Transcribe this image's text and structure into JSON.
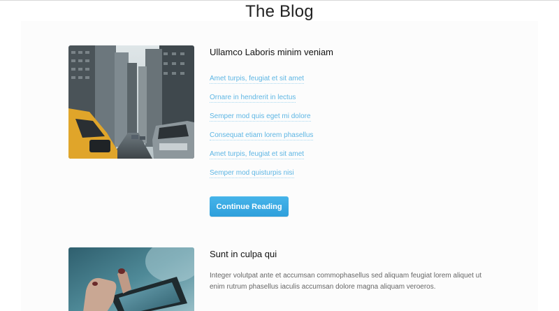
{
  "page": {
    "title": "The Blog"
  },
  "posts": [
    {
      "title": "Ullamco Laboris minim veniam",
      "image_icon": "city-street-photo",
      "links": [
        "Amet turpis, feugiat et sit amet",
        "Ornare in hendrerit in lectus",
        "Semper mod quis eget mi dolore",
        "Consequat etiam lorem phasellus",
        "Amet turpis, feugiat et sit amet",
        "Semper mod quisturpis nisi"
      ],
      "button_label": "Continue Reading"
    },
    {
      "title": "Sunt in culpa qui",
      "image_icon": "camera-hand-photo",
      "excerpt": "Integer volutpat ante et accumsan commophasellus sed aliquam feugiat lorem aliquet ut enim rutrum phasellus iaculis accumsan dolore magna aliquam veroeros."
    }
  ],
  "colors": {
    "link": "#5eb6e4",
    "button": "#2e9fdb",
    "title": "#222222"
  }
}
